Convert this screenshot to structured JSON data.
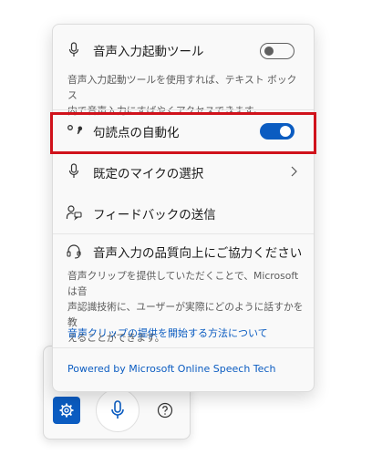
{
  "panel": {
    "voice_launcher": {
      "label": "音声入力起動ツール",
      "enabled": false,
      "desc_line1": "音声入力起動ツールを使用すれば、テキスト ボックス",
      "desc_line2": "内で音声入力にすばやくアクセスできます。"
    },
    "auto_punctuation": {
      "label": "句読点の自動化",
      "enabled": true
    },
    "default_mic": {
      "label": "既定のマイクの選択"
    },
    "feedback": {
      "label": "フィードバックの送信"
    },
    "improve": {
      "label": "音声入力の品質向上にご協力ください",
      "desc_line1": "音声クリップを提供していただくことで、Microsoft は音",
      "desc_line2": "声認識技術に、ユーザーが実際にどのように話すかを教",
      "desc_line3": "えることができます。",
      "link": "音声クリップの提供を開始する方法について"
    },
    "powered_by": "Powered by Microsoft Online Speech Tech"
  },
  "toolbar": {
    "settings_icon": "gear-icon",
    "mic_icon": "microphone-icon",
    "help_icon": "help-icon"
  },
  "colors": {
    "accent": "#0b5cc1",
    "highlight": "#d0121b"
  }
}
